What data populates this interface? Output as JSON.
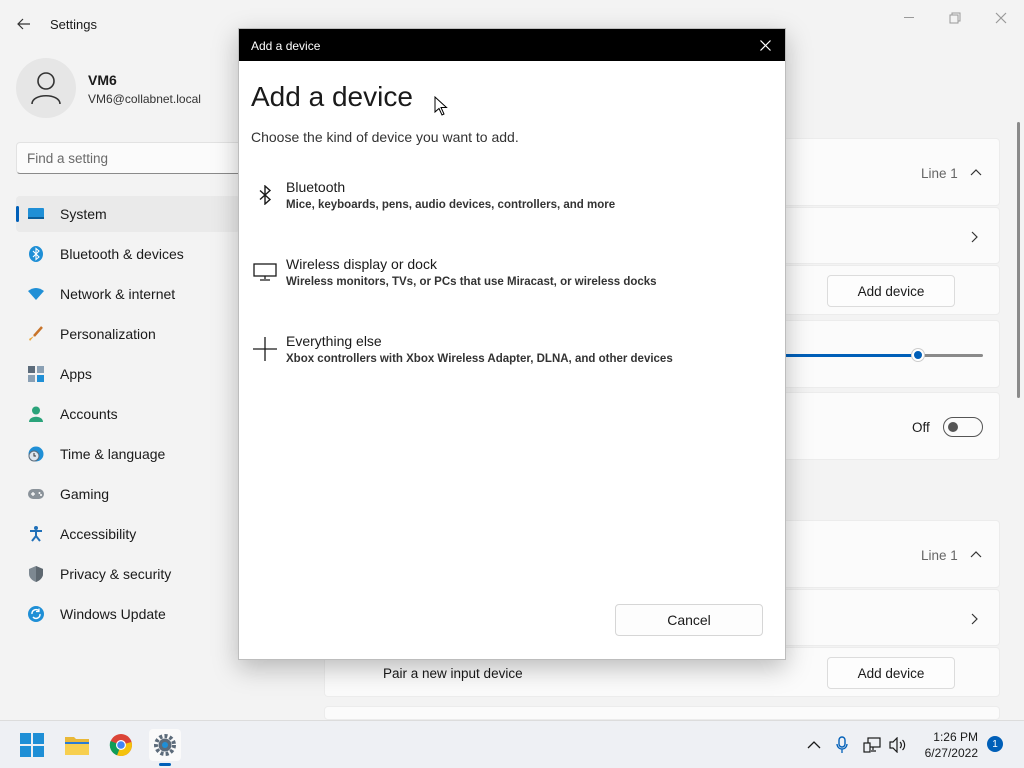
{
  "window": {
    "title": "Settings",
    "back_icon": "back-arrow-icon"
  },
  "profile": {
    "name": "VM6",
    "email": "VM6@collabnet.local"
  },
  "search": {
    "placeholder": "Find a setting"
  },
  "nav": {
    "items": [
      {
        "label": "System",
        "icon": "system-icon",
        "active": true
      },
      {
        "label": "Bluetooth & devices",
        "icon": "bluetooth-icon"
      },
      {
        "label": "Network & internet",
        "icon": "wifi-icon"
      },
      {
        "label": "Personalization",
        "icon": "brush-icon"
      },
      {
        "label": "Apps",
        "icon": "apps-icon"
      },
      {
        "label": "Accounts",
        "icon": "person-icon"
      },
      {
        "label": "Time & language",
        "icon": "clock-globe-icon"
      },
      {
        "label": "Gaming",
        "icon": "gamepad-icon"
      },
      {
        "label": "Accessibility",
        "icon": "accessibility-icon"
      },
      {
        "label": "Privacy & security",
        "icon": "shield-icon"
      },
      {
        "label": "Windows Update",
        "icon": "update-icon"
      }
    ]
  },
  "content": {
    "output_device": "Line 1",
    "add_device_label": "Add device",
    "toggle_state": "Off",
    "volume_level": 0.9,
    "input_device": "Line 1",
    "pair_input_label": "Pair a new input device",
    "add_device_label_2": "Add device"
  },
  "dialog": {
    "title": "Add a device",
    "heading": "Add a device",
    "subtitle": "Choose the kind of device you want to add.",
    "options": [
      {
        "title": "Bluetooth",
        "desc": "Mice, keyboards, pens, audio devices, controllers, and more",
        "icon": "bluetooth-icon"
      },
      {
        "title": "Wireless display or dock",
        "desc": "Wireless monitors, TVs, or PCs that use Miracast, or wireless docks",
        "icon": "monitor-icon"
      },
      {
        "title": "Everything else",
        "desc": "Xbox controllers with Xbox Wireless Adapter, DLNA, and other devices",
        "icon": "plus-icon"
      }
    ],
    "cancel_label": "Cancel"
  },
  "taskbar": {
    "time": "1:26 PM",
    "date": "6/27/2022",
    "notifications": "1",
    "accent": "#005fb8"
  }
}
